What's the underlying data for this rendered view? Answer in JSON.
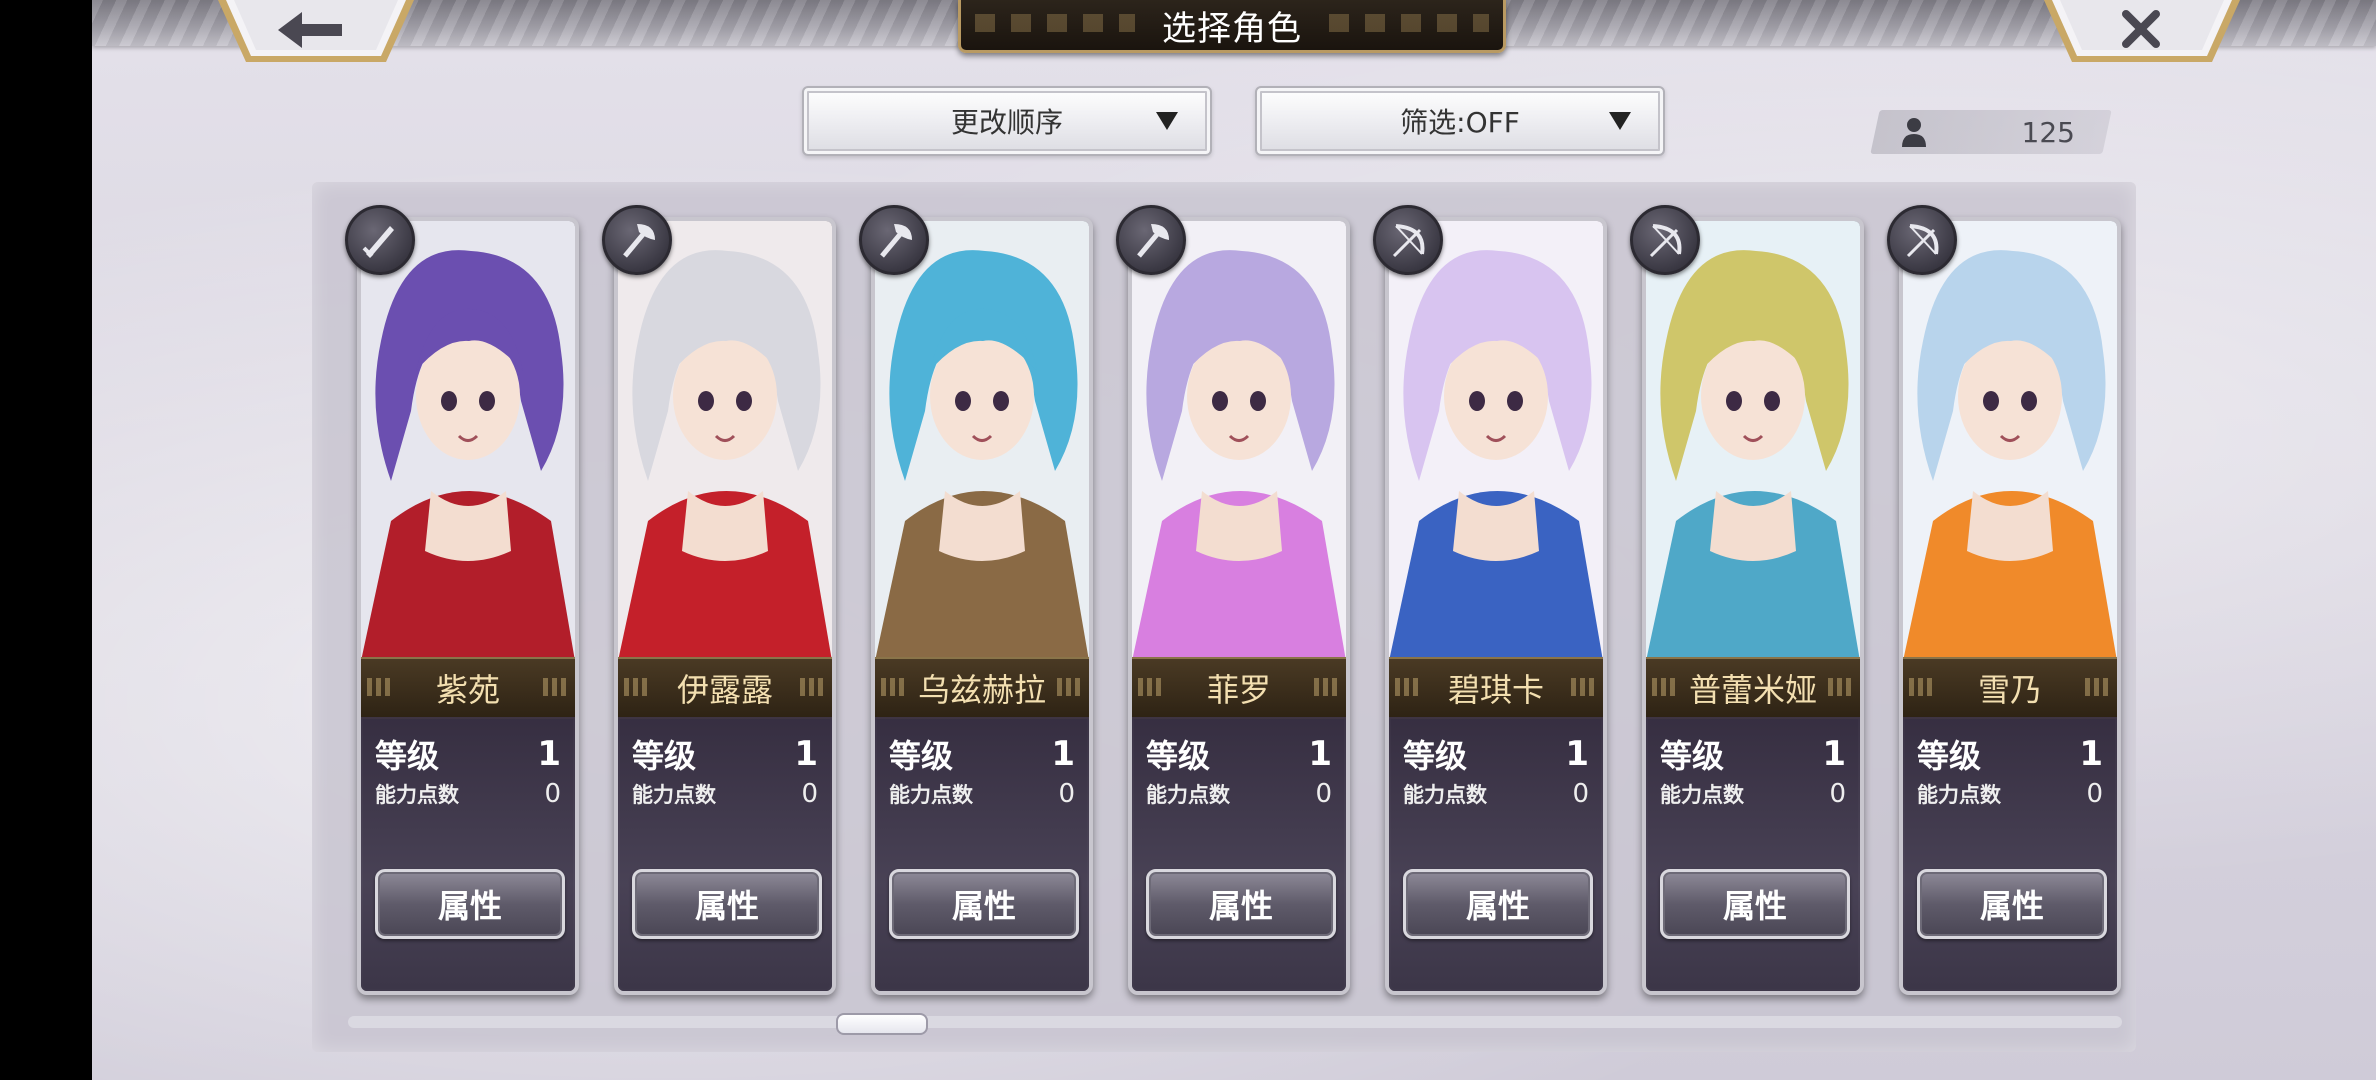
{
  "header": {
    "title": "选择角色",
    "back_icon": "arrow-left-icon",
    "close_icon": "close-x-icon"
  },
  "toolbar": {
    "sort_label": "更改顺序",
    "filter_label": "筛选:OFF",
    "count": "125"
  },
  "cards": [
    {
      "name": "紫苑",
      "level_label": "等级",
      "level": "1",
      "ap_label": "能力点数",
      "ap": "0",
      "button": "属性",
      "weapon": "sword-icon",
      "hair": "#6b4fb0",
      "accent": "#b21e2a",
      "bg": "#e6e6ee"
    },
    {
      "name": "伊露露",
      "level_label": "等级",
      "level": "1",
      "ap_label": "能力点数",
      "ap": "0",
      "button": "属性",
      "weapon": "axe-icon",
      "hair": "#d8d8df",
      "accent": "#c4202a",
      "bg": "#efeaec"
    },
    {
      "name": "乌兹赫拉",
      "level_label": "等级",
      "level": "1",
      "ap_label": "能力点数",
      "ap": "0",
      "button": "属性",
      "weapon": "axe-icon",
      "hair": "#4fb3d8",
      "accent": "#8a6a45",
      "bg": "#e9eef2"
    },
    {
      "name": "菲罗",
      "level_label": "等级",
      "level": "1",
      "ap_label": "能力点数",
      "ap": "0",
      "button": "属性",
      "weapon": "axe-icon",
      "hair": "#b8a8e0",
      "accent": "#d87fe0",
      "bg": "#f2f0f6"
    },
    {
      "name": "碧琪卡",
      "level_label": "等级",
      "level": "1",
      "ap_label": "能力点数",
      "ap": "0",
      "button": "属性",
      "weapon": "bow-icon",
      "hair": "#d8c4f0",
      "accent": "#3a63c2",
      "bg": "#f3f0f8"
    },
    {
      "name": "普蕾米娅",
      "level_label": "等级",
      "level": "1",
      "ap_label": "能力点数",
      "ap": "0",
      "button": "属性",
      "weapon": "bow-icon",
      "hair": "#cfc66a",
      "accent": "#4fa8c8",
      "bg": "#e7f1f6"
    },
    {
      "name": "雪乃",
      "level_label": "等级",
      "level": "1",
      "ap_label": "能力点数",
      "ap": "0",
      "button": "属性",
      "weapon": "bow-icon",
      "hair": "#b8d4ec",
      "accent": "#f08a2a",
      "bg": "#eef2f8"
    }
  ],
  "scrollbar": {
    "position": 0.29
  }
}
